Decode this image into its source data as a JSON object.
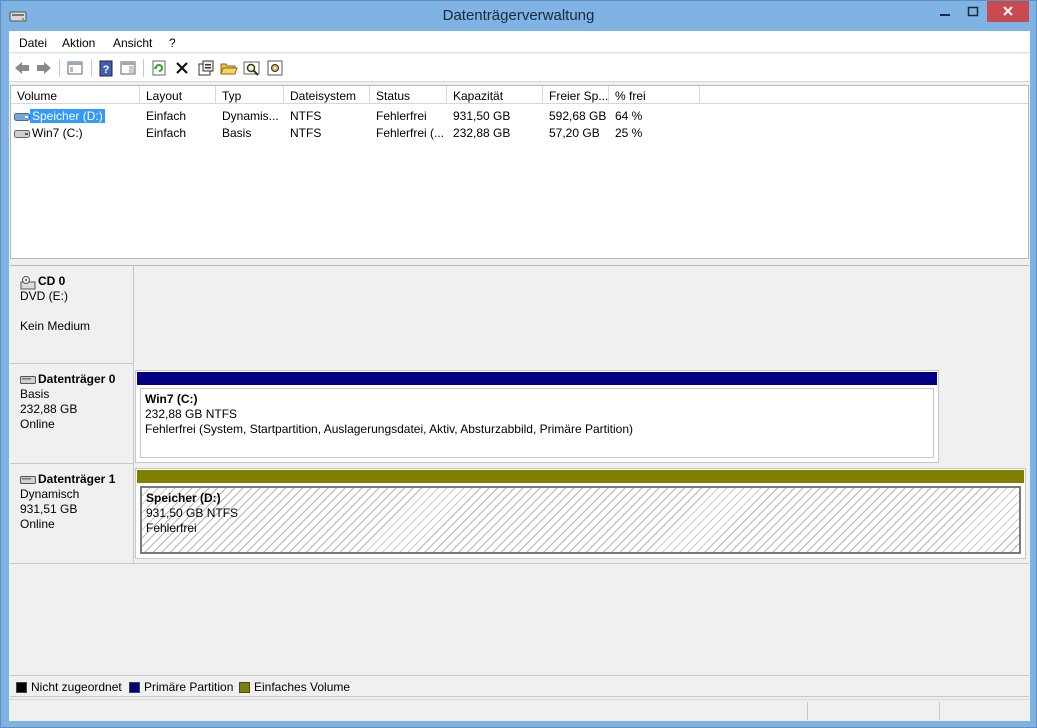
{
  "window": {
    "title": "Datenträgerverwaltung",
    "titlebar_color": "#7fb3e3",
    "close_button_color": "#c74b50"
  },
  "menu": {
    "items": [
      "Datei",
      "Aktion",
      "Ansicht",
      "?"
    ]
  },
  "toolbar": {
    "icons": [
      "back-arrow-icon",
      "forward-arrow-icon",
      "console-tree-icon",
      "help-icon",
      "view-panel-icon",
      "refresh-icon",
      "delete-icon",
      "properties-icon",
      "open-folder-icon",
      "search-icon",
      "settings-icon"
    ]
  },
  "volume_list": {
    "columns": [
      "Volume",
      "Layout",
      "Typ",
      "Dateisystem",
      "Status",
      "Kapazität",
      "Freier Sp...",
      "% frei"
    ],
    "rows": [
      {
        "volume": "Speicher (D:)",
        "layout": "Einfach",
        "typ": "Dynamis...",
        "dateisystem": "NTFS",
        "status": "Fehlerfrei",
        "kapazitaet": "931,50 GB",
        "frei": "592,68 GB",
        "prozent": "64 %",
        "selected": true
      },
      {
        "volume": "Win7 (C:)",
        "layout": "Einfach",
        "typ": "Basis",
        "dateisystem": "NTFS",
        "status": "Fehlerfrei (...",
        "kapazitaet": "232,88 GB",
        "frei": "57,20 GB",
        "prozent": "25 %",
        "selected": false
      }
    ]
  },
  "disks": {
    "cd0": {
      "name": "CD 0",
      "line1": "DVD (E:)",
      "line2": "Kein Medium"
    },
    "disk0": {
      "name": "Datenträger 0",
      "type": "Basis",
      "size": "232,88 GB",
      "state": "Online",
      "partition": {
        "name": "Win7  (C:)",
        "size": "232,88 GB NTFS",
        "status": "Fehlerfrei (System, Startpartition, Auslagerungsdatei, Aktiv, Absturzabbild, Primäre Partition)",
        "bar_color": "#000080"
      }
    },
    "disk1": {
      "name": "Datenträger 1",
      "type": "Dynamisch",
      "size": "931,51 GB",
      "state": "Online",
      "partition": {
        "name": "Speicher  (D:)",
        "size": "931,50 GB NTFS",
        "status": "Fehlerfrei",
        "bar_color": "#808000"
      }
    }
  },
  "legend": {
    "items": [
      {
        "label": "Nicht zugeordnet",
        "color": "#000000"
      },
      {
        "label": "Primäre Partition",
        "color": "#000080"
      },
      {
        "label": "Einfaches Volume",
        "color": "#808000"
      }
    ]
  }
}
